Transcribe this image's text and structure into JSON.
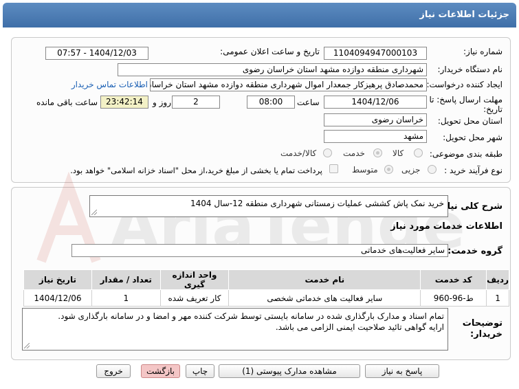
{
  "title": "جزئیات اطلاعات نیاز",
  "form": {
    "need_number_label": "شماره نیاز:",
    "need_number": "1104094947000103",
    "announce_label": "تاریخ و ساعت اعلان عمومی:",
    "announce_value": "1404/12/03 - 07:57",
    "buyer_org_label": "نام دستگاه خریدار:",
    "buyer_org": "شهرداری منطقه دوازده مشهد استان خراسان رضوی",
    "creator_label": "ایجاد کننده درخواست:",
    "creator": "محمدصادق پرهیزکار جمعدار اموال شهرداری منطقه دوازده مشهد استان خراسان رضوی",
    "contact_link": "اطلاعات تماس خریدار",
    "deadline_label": "مهلت ارسال پاسخ: تا تاریخ:",
    "deadline_date": "1404/12/06",
    "time_label": "ساعت",
    "deadline_time": "08:00",
    "days_value": "2",
    "days_label": "روز و",
    "remaining_time": "23:42:14",
    "remaining_label": "ساعت باقی مانده",
    "province_label": "استان محل تحویل:",
    "province": "خراسان رضوی",
    "city_label": "شهر محل تحویل:",
    "city": "مشهد",
    "category_label": "طبقه بندی موضوعی:",
    "category_options": [
      "کالا",
      "خدمت",
      "کالا/خدمت"
    ],
    "process_label": "نوع فرآیند خرید :",
    "process_options": [
      "جزیی",
      "متوسط"
    ],
    "payment_note": "پرداخت تمام یا بخشی از مبلغ خرید،از محل \"اسناد خزانه اسلامی\" خواهد بود."
  },
  "details": {
    "summary_label": "شرح کلی نیاز:",
    "summary": "خرید نمک پاش کششی عملیات زمستانی شهرداری منطقه 12-سال 1404",
    "services_heading": "اطلاعات خدمات مورد نیاز",
    "service_group_label": "گروه خدمت:",
    "service_group": "سایر فعالیت‌های خدماتی",
    "table": {
      "headers": [
        "ردیف",
        "کد خدمت",
        "نام خدمت",
        "واحد اندازه گیری",
        "تعداد / مقدار",
        "تاریخ نیاز"
      ],
      "rows": [
        [
          "1",
          "ط-96-960",
          "سایر فعالیت های خدماتی شخصی",
          "کار تعریف شده",
          "1",
          "1404/12/06"
        ]
      ]
    },
    "buyer_notes_label": "توضیحات خریدار:",
    "buyer_notes_line1": "تمام اسناد و مدارک بارگذاری شده در سامانه بایستی توسط شرکت کننده مهر و امضا و در سامانه بارگذاری شود.",
    "buyer_notes_line2": "ارایه گواهی تائید صلاحیت ایمنی الزامی می باشد."
  },
  "buttons": {
    "reply": "پاسخ به نیاز",
    "attachments": "مشاهده مدارک پیوستی (1)",
    "print": "چاپ",
    "back": "بازگشت",
    "exit": "خروج"
  },
  "watermark_text": "AriaTender.net",
  "colors": {
    "title_bar": "#4a7ab3",
    "link": "#1a5fb4",
    "remaining_bg": "#f3f1c6",
    "exit_bg": "#f4c6c6"
  }
}
